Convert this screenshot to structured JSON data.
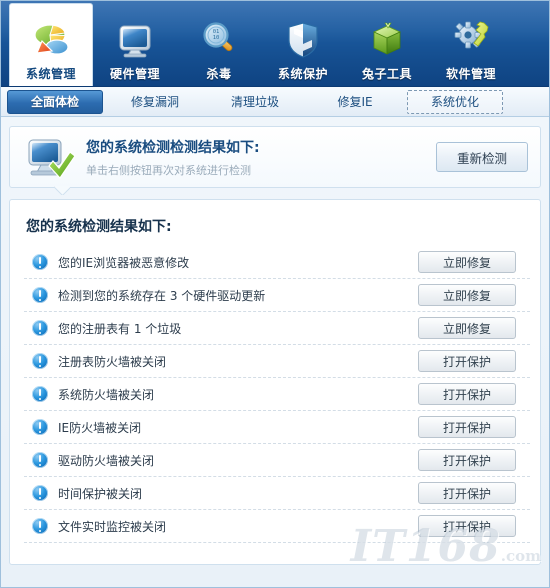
{
  "toolbar": {
    "items": [
      {
        "label": "系统管理",
        "icon": "pie-chart-icon",
        "active": true
      },
      {
        "label": "硬件管理",
        "icon": "monitor-icon",
        "active": false
      },
      {
        "label": "杀毒",
        "icon": "magnifier-icon",
        "active": false
      },
      {
        "label": "系统保护",
        "icon": "shield-icon",
        "active": false
      },
      {
        "label": "兔子工具",
        "icon": "green-box-icon",
        "active": false
      },
      {
        "label": "软件管理",
        "icon": "gear-wrench-icon",
        "active": false
      }
    ]
  },
  "subtabs": {
    "items": [
      {
        "label": "全面体检",
        "state": "active"
      },
      {
        "label": "修复漏洞",
        "state": "normal"
      },
      {
        "label": "清理垃圾",
        "state": "normal"
      },
      {
        "label": "修复IE",
        "state": "normal"
      },
      {
        "label": "系统优化",
        "state": "focused"
      }
    ]
  },
  "banner": {
    "icon": "monitor-check-icon",
    "title": "您的系统检测检测结果如下:",
    "subtitle": "单击右侧按钮再次对系统进行检测",
    "rescan_label": "重新检测"
  },
  "results": {
    "title": "您的系统检测结果如下:",
    "rows": [
      {
        "icon": "warning-icon",
        "text": "您的IE浏览器被恶意修改",
        "action": "立即修复"
      },
      {
        "icon": "warning-icon",
        "text": "检测到您的系统存在 3 个硬件驱动更新",
        "action": "立即修复"
      },
      {
        "icon": "warning-icon",
        "text": "您的注册表有 1 个垃圾",
        "action": "立即修复"
      },
      {
        "icon": "warning-icon",
        "text": "注册表防火墙被关闭",
        "action": "打开保护"
      },
      {
        "icon": "warning-icon",
        "text": "系统防火墙被关闭",
        "action": "打开保护"
      },
      {
        "icon": "warning-icon",
        "text": "IE防火墙被关闭",
        "action": "打开保护"
      },
      {
        "icon": "warning-icon",
        "text": "驱动防火墙被关闭",
        "action": "打开保护"
      },
      {
        "icon": "warning-icon",
        "text": "时间保护被关闭",
        "action": "打开保护"
      },
      {
        "icon": "warning-icon",
        "text": "文件实时监控被关闭",
        "action": "打开保护"
      }
    ]
  },
  "watermark": {
    "text": "IT168",
    "domain": ".com"
  },
  "colors": {
    "toolbar_blue": "#14497f",
    "accent_blue": "#2c6cb0",
    "warning_blue": "#1277c4",
    "panel_border": "#cfe0ee",
    "text_dark": "#2c3c4c"
  }
}
